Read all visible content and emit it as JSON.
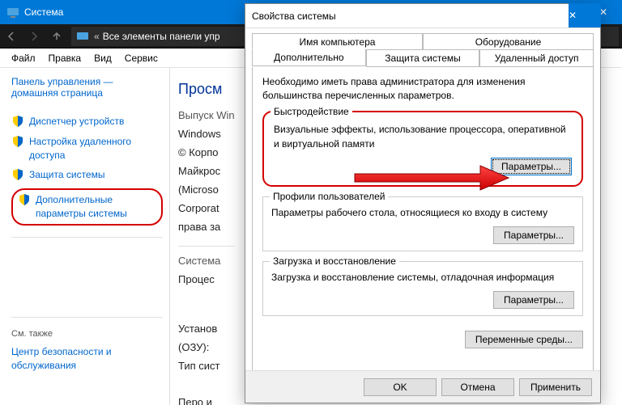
{
  "window": {
    "title": "Система",
    "address": "Все элементы панели упр",
    "minimize": "—",
    "maximize": "□",
    "close": "✕"
  },
  "menu": {
    "file": "Файл",
    "edit": "Правка",
    "view": "Вид",
    "tools": "Сервис"
  },
  "sidebar": {
    "home1": "Панель управления —",
    "home2": "домашняя страница",
    "items": [
      "Диспетчер устройств",
      "Настройка удаленного доступа",
      "Защита системы",
      "Дополнительные параметры системы"
    ],
    "seealso": "См. также",
    "security": "Центр безопасности и обслуживания"
  },
  "content": {
    "heading": "Просм",
    "edition_lbl": "Выпуск Win",
    "edition_val": "Windows",
    "copyright": "© Корпо",
    "copyright2": "Майкрос",
    "copyright3": "(Microso",
    "copyright4": "Corporat",
    "copyright5": "права за",
    "system_lbl": "Система",
    "proc": "Процес",
    "ram": "Установ",
    "ram2": "(ОЗУ):",
    "type": "Тип сист",
    "pen": "Перо и "
  },
  "dialog": {
    "title": "Свойства системы",
    "close": "✕",
    "tabs_top": [
      "Имя компьютера",
      "Оборудование"
    ],
    "tabs_bot": [
      "Дополнительно",
      "Защита системы",
      "Удаленный доступ"
    ],
    "intro": "Необходимо иметь права администратора для изменения большинства перечисленных параметров.",
    "perf": {
      "legend": "Быстродействие",
      "desc": "Визуальные эффекты, использование процессора, оперативной и виртуальной памяти",
      "btn": "Параметры..."
    },
    "profiles": {
      "legend": "Профили пользователей",
      "desc": "Параметры рабочего стола, относящиеся ко входу в систему",
      "btn": "Параметры..."
    },
    "startup": {
      "legend": "Загрузка и восстановление",
      "desc": "Загрузка и восстановление системы, отладочная информация",
      "btn": "Параметры..."
    },
    "env_btn": "Переменные среды...",
    "ok": "OK",
    "cancel": "Отмена",
    "apply": "Применить"
  }
}
